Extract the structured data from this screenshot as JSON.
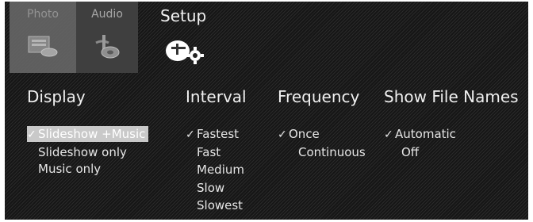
{
  "tabs": [
    {
      "label": "Photo",
      "icon": "photo-icon",
      "active": false
    },
    {
      "label": "Audio",
      "icon": "audio-icon",
      "active": false
    },
    {
      "label": "Setup",
      "icon": "setup-icon",
      "active": true
    }
  ],
  "columns": [
    {
      "header": "Display",
      "options": [
        {
          "label": "Slideshow +Music",
          "selected": true
        },
        {
          "label": "Slideshow only",
          "selected": false
        },
        {
          "label": "Music only",
          "selected": false
        }
      ]
    },
    {
      "header": "Interval",
      "options": [
        {
          "label": "Fastest",
          "selected": true
        },
        {
          "label": "Fast",
          "selected": false
        },
        {
          "label": "Medium",
          "selected": false
        },
        {
          "label": "Slow",
          "selected": false
        },
        {
          "label": "Slowest",
          "selected": false
        }
      ]
    },
    {
      "header": "Frequency",
      "options": [
        {
          "label": "Once",
          "selected": true
        },
        {
          "label": "Continuous",
          "selected": false
        }
      ]
    },
    {
      "header": "Show File Names",
      "options": [
        {
          "label": "Automatic",
          "selected": true
        },
        {
          "label": "Off",
          "selected": false
        }
      ]
    }
  ],
  "check_glyph": "✓",
  "colors": {
    "background": "#1a1a1a",
    "text": "#e8e8e8",
    "highlight": "#c9c9c9",
    "active_tab_label": "#f2f2f2"
  }
}
